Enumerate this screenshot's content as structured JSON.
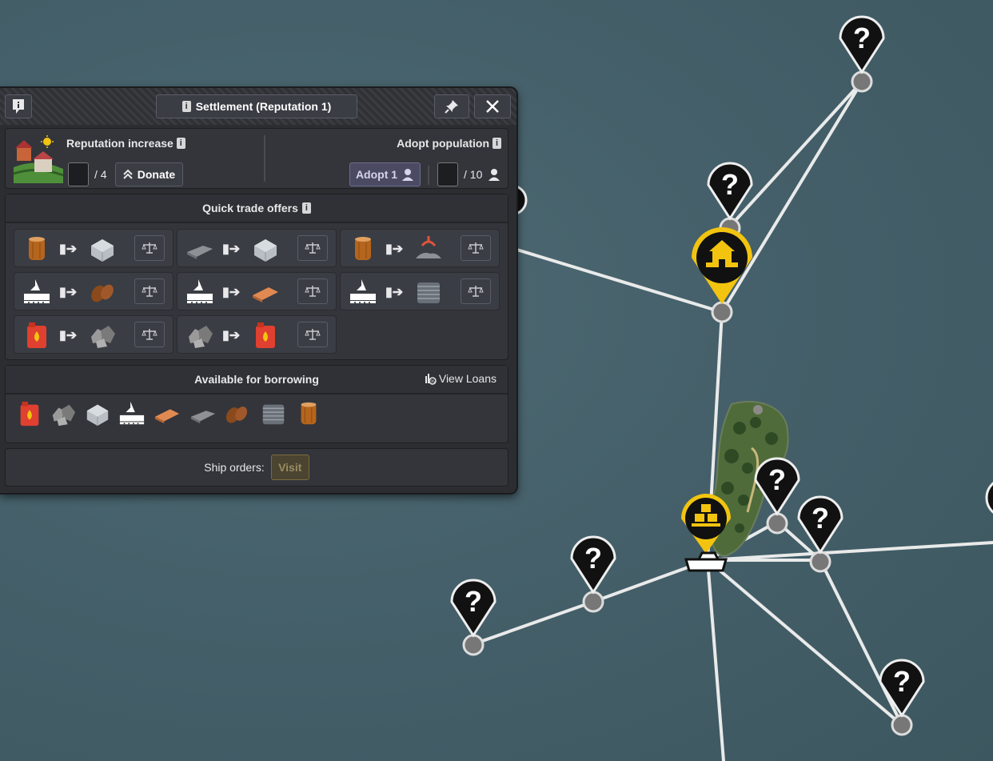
{
  "panel": {
    "title": "Settlement (Reputation 1)",
    "reputation": {
      "label": "Reputation increase",
      "input_value": "",
      "max": "/ 4",
      "donate_label": "Donate"
    },
    "adopt": {
      "label": "Adopt population",
      "button_label": "Adopt 1",
      "input_value": "",
      "max": "/ 10"
    },
    "quick_trade": {
      "label": "Quick trade offers",
      "offers": [
        {
          "from": "wood-log-icon",
          "to": "concrete-block-icon"
        },
        {
          "from": "iron-plate-icon",
          "to": "concrete-block-icon"
        },
        {
          "from": "wood-log-icon",
          "to": "scrap-claw-icon"
        },
        {
          "from": "food-crate-icon",
          "to": "bread-icon"
        },
        {
          "from": "food-crate-icon",
          "to": "wood-plank-icon"
        },
        {
          "from": "food-crate-icon",
          "to": "steel-coil-icon"
        },
        {
          "from": "fuel-canister-icon",
          "to": "stone-rubble-icon"
        },
        {
          "from": "stone-rubble-icon",
          "to": "fuel-canister-icon"
        }
      ]
    },
    "borrowing": {
      "label": "Available for borrowing",
      "view_loans": "View Loans",
      "items": [
        "fuel-canister-icon",
        "stone-rubble-icon",
        "concrete-block-icon",
        "food-crate-icon",
        "wood-plank-icon",
        "iron-plate-icon",
        "bread-icon",
        "steel-coil-icon",
        "wood-log-icon"
      ]
    },
    "ship_orders": {
      "label": "Ship orders:",
      "visit_label": "Visit"
    }
  },
  "map": {
    "unknown_marker_text": "?"
  },
  "colors": {
    "accent_yellow": "#f2c40f",
    "panel_bg": "#2b2d31",
    "adopt_button": "#4a4a62"
  }
}
